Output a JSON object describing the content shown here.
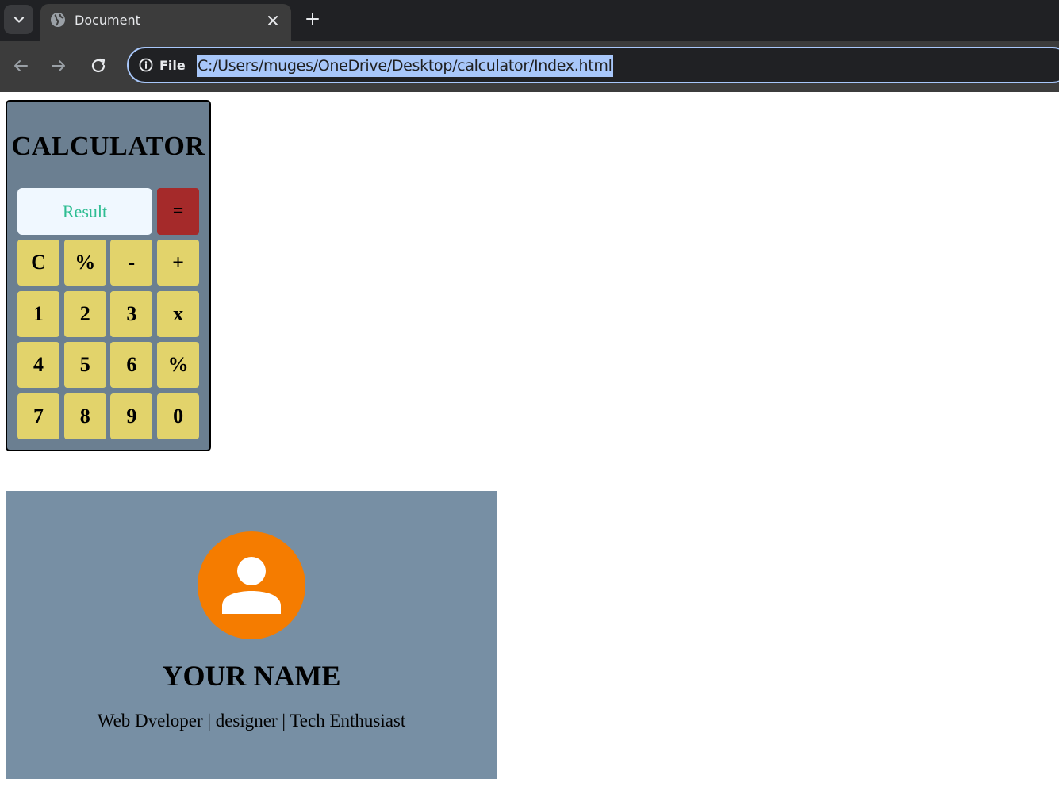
{
  "browser": {
    "tab_title": "Document",
    "scheme_label": "File",
    "url": "C:/Users/muges/OneDrive/Desktop/calculator/Index.html",
    "icons": [
      "chevron-down-icon",
      "globe-icon",
      "close-icon",
      "plus-icon",
      "back-arrow-icon",
      "forward-arrow-icon",
      "reload-icon",
      "info-icon"
    ]
  },
  "calculator": {
    "title": "CALCULATOR",
    "result_placeholder": "Result",
    "equals_label": "=",
    "keys": [
      {
        "label": "C",
        "name": "clear"
      },
      {
        "label": "%",
        "name": "percent"
      },
      {
        "label": "-",
        "name": "minus"
      },
      {
        "label": "+",
        "name": "plus"
      },
      {
        "label": "1",
        "name": "1"
      },
      {
        "label": "2",
        "name": "2"
      },
      {
        "label": "3",
        "name": "3"
      },
      {
        "label": "x",
        "name": "multiply"
      },
      {
        "label": "4",
        "name": "4"
      },
      {
        "label": "5",
        "name": "5"
      },
      {
        "label": "6",
        "name": "6"
      },
      {
        "label": "%",
        "name": "percent-2"
      },
      {
        "label": "7",
        "name": "7"
      },
      {
        "label": "8",
        "name": "8"
      },
      {
        "label": "9",
        "name": "9"
      },
      {
        "label": "0",
        "name": "0"
      }
    ],
    "colors": {
      "panel": "#6b7f91",
      "key": "#e2d36b",
      "equals": "#a52a2a",
      "result_bg": "#f0f8ff",
      "result_text": "#2ebd92"
    }
  },
  "profile": {
    "name": "YOUR NAME",
    "tagline": "Web Dveloper | designer | Tech Enthusiast",
    "avatar_icon": "person-icon",
    "colors": {
      "card": "#778fa4",
      "avatar": "#f57c00"
    }
  }
}
